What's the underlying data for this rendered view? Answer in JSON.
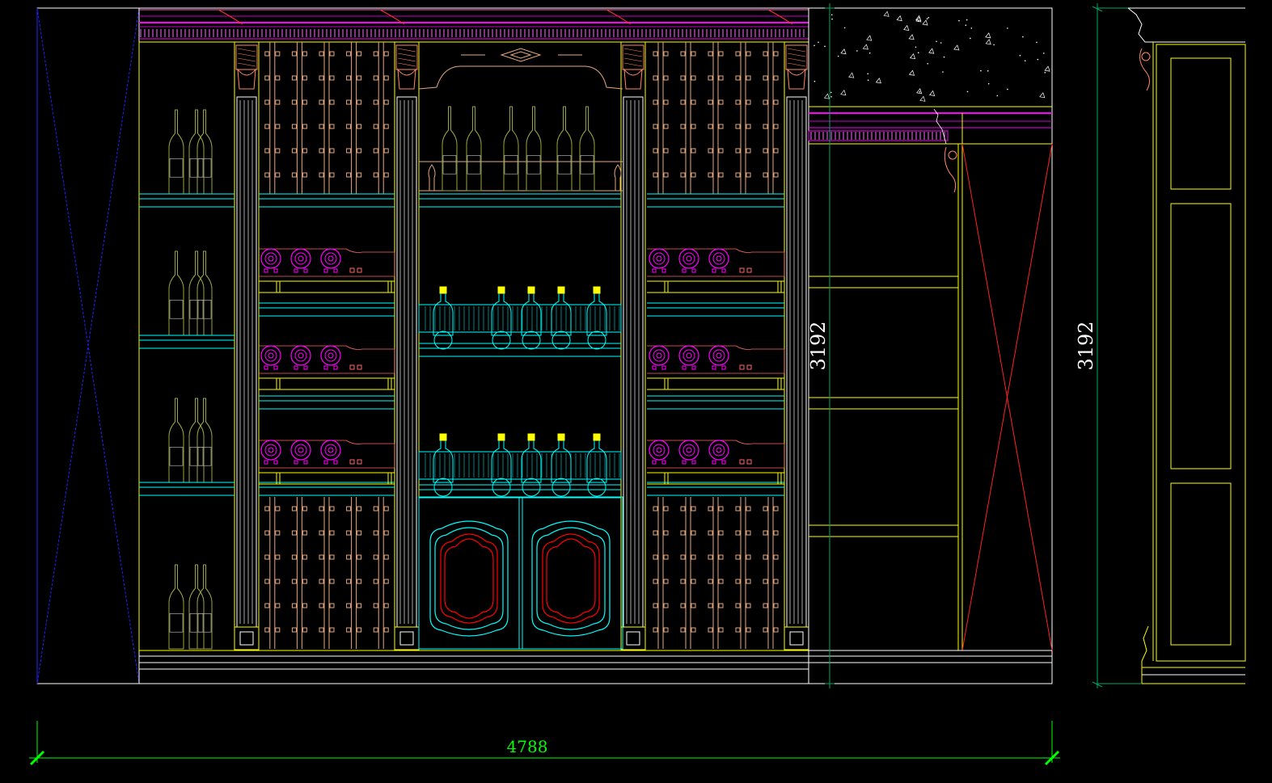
{
  "drawing": {
    "dimensions": {
      "overall_width": "4788",
      "height_front": "3192",
      "height_side": "3192"
    },
    "colors": {
      "background": "#000000",
      "frame": "#ffff00",
      "outline": "#ffffff",
      "shelf": "#00ffff",
      "rack": "#e6a77a",
      "bottle_rack": "#ff00ff",
      "cornice": "#cc00cc",
      "ornament": "#ff8866",
      "dimension": "#00ff00",
      "diagonal_red": "#ff0000",
      "diagonal_blue": "#0000ff",
      "side_dim": "#008855",
      "door_inner": "#ff0000",
      "bottle_olive": "#9aa340"
    }
  }
}
